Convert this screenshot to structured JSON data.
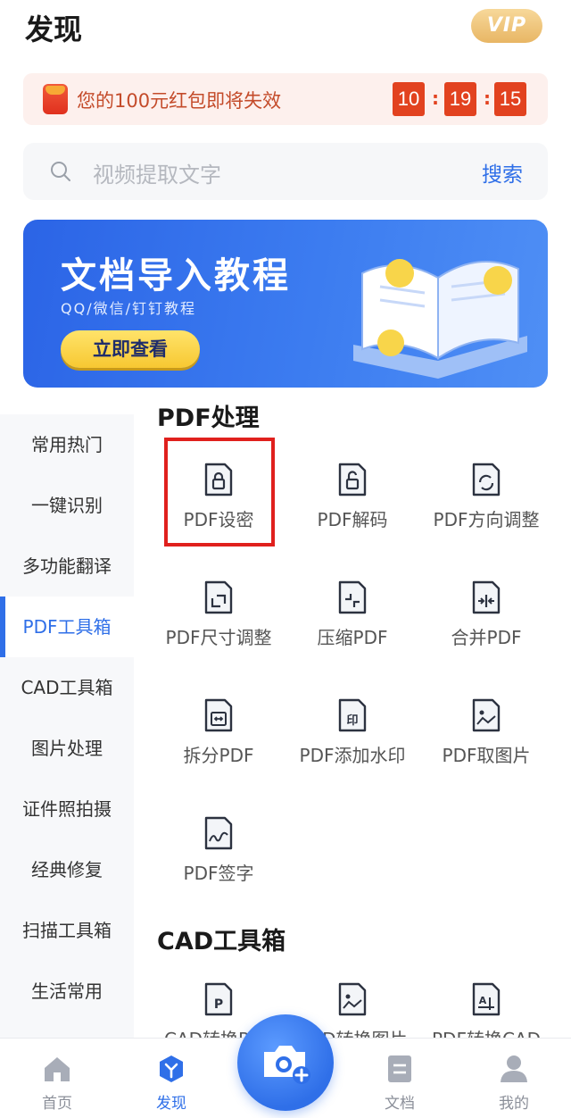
{
  "header": {
    "title": "发现",
    "vip_label": "VIP"
  },
  "promo": {
    "text": "您的100元红包即将失效",
    "timer": [
      "10",
      "19",
      "15"
    ],
    "separator": ":"
  },
  "search": {
    "placeholder": "视频提取文字",
    "button_label": "搜索"
  },
  "banner": {
    "title": "文档导入教程",
    "subtitle": "QQ/微信/钉钉教程",
    "button_label": "立即查看"
  },
  "sidebar": {
    "items": [
      {
        "label": "常用热门"
      },
      {
        "label": "一键识别"
      },
      {
        "label": "多功能翻译"
      },
      {
        "label": "PDF工具箱"
      },
      {
        "label": "CAD工具箱"
      },
      {
        "label": "图片处理"
      },
      {
        "label": "证件照拍摄"
      },
      {
        "label": "经典修复"
      },
      {
        "label": "扫描工具箱"
      },
      {
        "label": "生活常用"
      }
    ],
    "active_index": 3
  },
  "sections": [
    {
      "title": "PDF处理",
      "tools": [
        {
          "label": "PDF设密",
          "icon": "lock-file-icon"
        },
        {
          "label": "PDF解码",
          "icon": "unlock-file-icon"
        },
        {
          "label": "PDF方向调整",
          "icon": "rotate-file-icon"
        },
        {
          "label": "PDF尺寸调整",
          "icon": "resize-file-icon"
        },
        {
          "label": "压缩PDF",
          "icon": "compress-file-icon"
        },
        {
          "label": "合并PDF",
          "icon": "merge-file-icon"
        },
        {
          "label": "拆分PDF",
          "icon": "split-file-icon"
        },
        {
          "label": "PDF添加水印",
          "icon": "watermark-file-icon"
        },
        {
          "label": "PDF取图片",
          "icon": "image-file-icon"
        },
        {
          "label": "PDF签字",
          "icon": "signature-file-icon"
        }
      ]
    },
    {
      "title": "CAD工具箱",
      "tools": [
        {
          "label": "CAD转换PDF",
          "icon": "cad-to-pdf-icon"
        },
        {
          "label": "CAD转换图片",
          "icon": "cad-to-image-icon"
        },
        {
          "label": "PDF转换CAD",
          "icon": "pdf-to-cad-icon"
        }
      ]
    }
  ],
  "bottom_nav": {
    "items": [
      {
        "label": "首页",
        "icon": "home-icon"
      },
      {
        "label": "发现",
        "icon": "discover-icon"
      },
      {
        "label": "文档",
        "icon": "document-icon"
      },
      {
        "label": "我的",
        "icon": "profile-icon"
      }
    ],
    "active_index": 1,
    "camera_icon": "camera-add-icon"
  },
  "colors": {
    "accent": "#2f6fe8",
    "promo_red": "#e2421f",
    "highlight_red": "#e0201d",
    "vip_gold": "#e8b664"
  }
}
